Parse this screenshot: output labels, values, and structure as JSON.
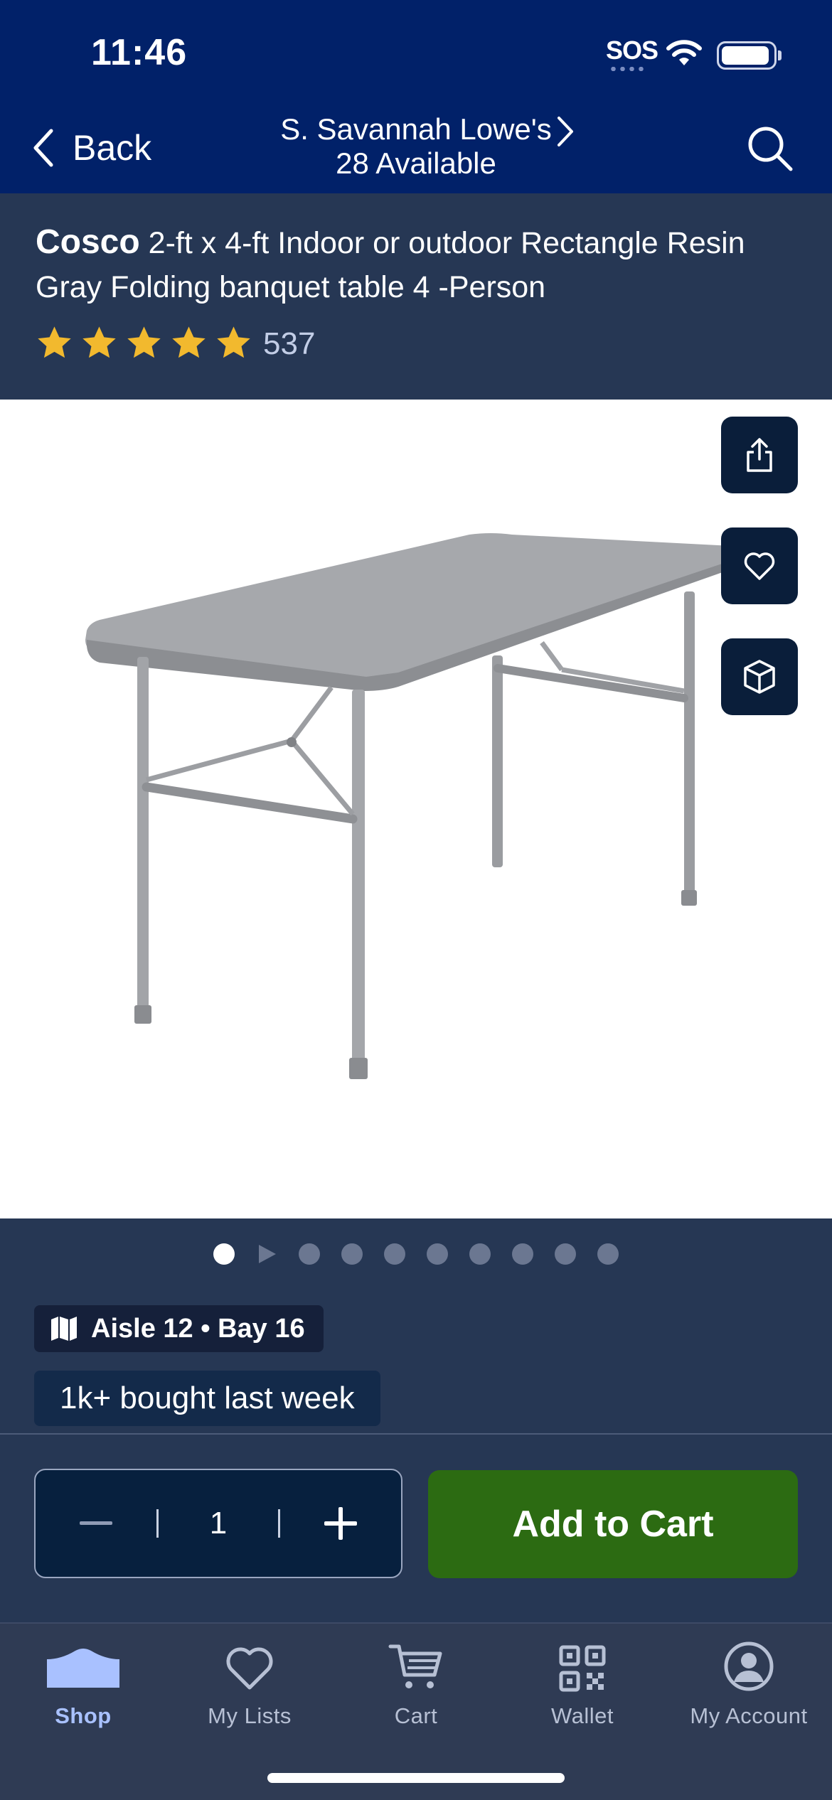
{
  "status_bar": {
    "time": "11:46",
    "sos": "SOS"
  },
  "header": {
    "back_label": "Back",
    "store_name": "S. Savannah Lowe's",
    "store_availability": "28 Available"
  },
  "product": {
    "brand": "Cosco",
    "title": "2-ft x 4-ft Indoor or outdoor Rectangle Resin Gray Folding banquet table 4 -Person",
    "rating_stars": 5,
    "review_count": "537"
  },
  "gallery": {
    "total_items": 10,
    "active_index": 0,
    "video_index": 1
  },
  "location_badge": {
    "text": "Aisle 12 • Bay 16"
  },
  "social_proof": {
    "text": "1k+ bought last week"
  },
  "quantity": {
    "value": "1"
  },
  "cta": {
    "add_to_cart": "Add to Cart"
  },
  "bottom_nav": {
    "items": [
      {
        "label": "Shop",
        "icon": "shop-icon",
        "active": true
      },
      {
        "label": "My Lists",
        "icon": "heart-icon",
        "active": false
      },
      {
        "label": "Cart",
        "icon": "cart-icon",
        "active": false
      },
      {
        "label": "Wallet",
        "icon": "qr-code-icon",
        "active": false
      },
      {
        "label": "My Account",
        "icon": "account-icon",
        "active": false
      }
    ]
  },
  "colors": {
    "header_bg": "#012169",
    "page_bg": "#263754",
    "cta_green": "#2c6b12",
    "star_gold": "#f2b92e"
  }
}
